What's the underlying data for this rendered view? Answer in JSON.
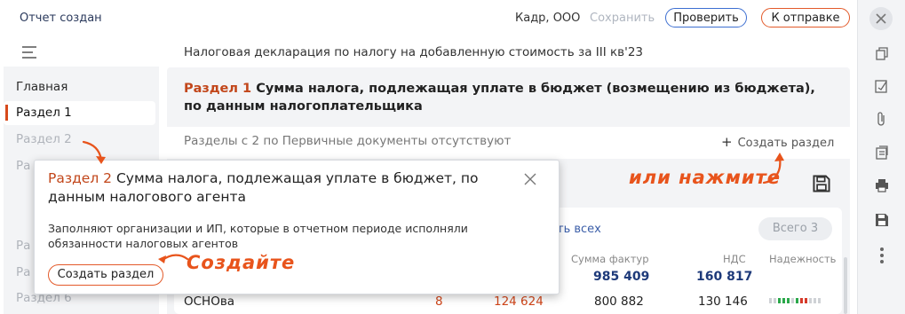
{
  "header": {
    "status": "Отчет создан",
    "company": "Кадр, ООО",
    "save": "Сохранить",
    "check": "Проверить",
    "send": "К отправке"
  },
  "doc_title": "Налоговая декларация по налогу на добавленную стоимость за III кв'23",
  "sidebar": {
    "items": [
      {
        "label": "Главная"
      },
      {
        "label": "Раздел 1"
      },
      {
        "label": "Раздел 2"
      },
      {
        "label": "Ра"
      },
      {
        "label": "Ра"
      },
      {
        "label": "Ра"
      },
      {
        "label": "Раздел 6"
      }
    ]
  },
  "section": {
    "num": "Раздел 1",
    "title": " Сумма налога, подлежащая уплате в бюджет (возмещению из бюджета), по данным налогоплательщика",
    "empty_note": "Разделы с 2 по Первичные документы отсутствуют",
    "create": "Создать раздел"
  },
  "card": {
    "show_all": "ть всех",
    "total_btn": "Всего 3",
    "columns": {
      "sum": "Сумма фактур",
      "vat": "НДС",
      "reliability": "Надежность"
    },
    "totals": {
      "sum": "985 409",
      "vat": "160 817"
    },
    "row": {
      "name": "ОСНОва",
      "count": "8",
      "red": "124 624",
      "sum": "800 882",
      "vat": "130 146"
    }
  },
  "tooltip": {
    "num": "Раздел 2",
    "title": " Сумма налога, подлежащая уплате в бюджет, по данным налогового агента",
    "text": "Заполняют организации и ИП, которые в отчетном периоде исполняли обязанности налоговых агентов",
    "button": "Создать раздел"
  },
  "hints": {
    "or_click": "или нажмите",
    "create": "Создайте"
  },
  "colors": {
    "accent": "#e35a2a",
    "link": "#3d6fd1",
    "section_num": "#c2461a",
    "navy": "#1e3a7a"
  }
}
